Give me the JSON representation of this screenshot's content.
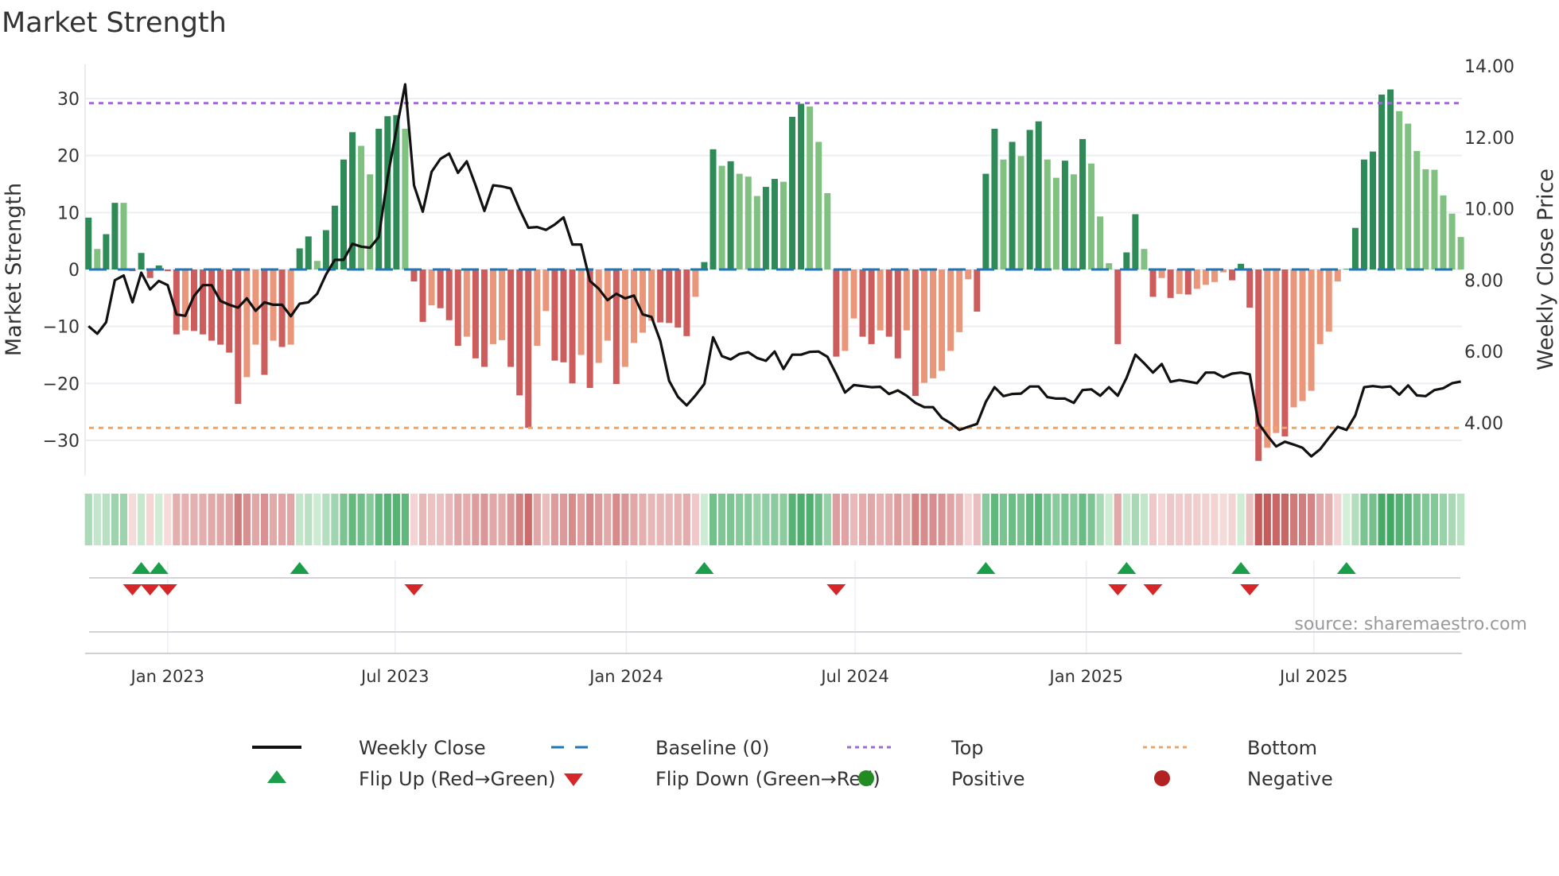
{
  "title": "Market Strength",
  "source": "source: sharemaestro.com",
  "chart_data": {
    "type": "bar",
    "title": "Market Strength",
    "ylabel": "Market Strength",
    "y2label": "Weekly Close Price",
    "ylim": [
      -36,
      36
    ],
    "y2lim": [
      2.55,
      14.05
    ],
    "yticks": [
      "30",
      "20",
      "10",
      "0",
      "−10",
      "−20",
      "−30"
    ],
    "ytick_values": [
      30,
      20,
      10,
      0,
      -10,
      -20,
      -30
    ],
    "y2ticks": [
      "14.00",
      "12.00",
      "10.00",
      "8.00",
      "6.00",
      "4.00"
    ],
    "y2tick_values": [
      14,
      12,
      10,
      8,
      6,
      4
    ],
    "xticks": [
      {
        "label": "Jan 2023",
        "date": "2023-01-01"
      },
      {
        "label": "Jul 2023",
        "date": "2023-07-01"
      },
      {
        "label": "Jan 2024",
        "date": "2024-01-01"
      },
      {
        "label": "Jul 2024",
        "date": "2024-07-01"
      },
      {
        "label": "Jan 2025",
        "date": "2025-01-01"
      },
      {
        "label": "Jul 2025",
        "date": "2025-07-01"
      }
    ],
    "x_start": "2022-10-30",
    "x_step_days": 7,
    "grid": true,
    "top_level": 29.2,
    "bottom_level": -27.8,
    "baseline": 0,
    "strength_values": [
      9.1,
      3.6,
      6.2,
      11.7,
      11.7,
      -0.3,
      2.9,
      -1.5,
      0.7,
      -0.3,
      -11.4,
      -10.7,
      -10.8,
      -11.4,
      -12.5,
      -13.2,
      -14.6,
      -23.6,
      -18.9,
      -13.2,
      -18.5,
      -12.5,
      -13.6,
      -13.2,
      3.7,
      5.8,
      1.5,
      6.9,
      11.2,
      19.3,
      24.1,
      21.7,
      16.7,
      24.7,
      26.9,
      27.1,
      24.7,
      -2.1,
      -9.2,
      -6.3,
      -6.8,
      -8.9,
      -13.4,
      -11.8,
      -15.6,
      -17.1,
      -13.1,
      -12.4,
      -17.1,
      -22.1,
      -27.8,
      -13.4,
      -7.3,
      -16.0,
      -16.3,
      -20.0,
      -15.0,
      -20.8,
      -16.4,
      -12.5,
      -20.1,
      -17.1,
      -12.9,
      -11.1,
      -9.0,
      -9.3,
      -9.4,
      -10.2,
      -11.7,
      -4.8,
      1.3,
      21.1,
      18.2,
      19.0,
      16.8,
      16.3,
      12.9,
      14.5,
      15.9,
      15.4,
      26.8,
      29.1,
      28.6,
      22.4,
      13.4,
      -15.3,
      -14.3,
      -8.6,
      -11.8,
      -13.1,
      -10.7,
      -11.8,
      -15.6,
      -10.7,
      -22.2,
      -19.9,
      -19.1,
      -17.8,
      -14.3,
      -11.0,
      -1.7,
      -7.4,
      16.8,
      24.7,
      19.3,
      22.4,
      19.9,
      24.5,
      26.0,
      19.3,
      16.1,
      19.1,
      16.7,
      22.9,
      18.6,
      9.3,
      1.1,
      -13.1,
      3.0,
      9.7,
      3.6,
      -4.8,
      -1.5,
      -5.0,
      -4.3,
      -4.4,
      -3.4,
      -2.7,
      -2.2,
      -0.5,
      -1.9,
      1.0,
      -6.7,
      -33.6,
      -31.3,
      -28.7,
      -29.3,
      -24.2,
      -23.1,
      -21.3,
      -13.1,
      -10.9,
      -2.1,
      0.1,
      7.3,
      19.3,
      20.7,
      30.7,
      31.6,
      27.8,
      25.6,
      20.8,
      17.6,
      17.5,
      13.0,
      9.8,
      5.7
    ],
    "weekly_close": [
      6.71,
      6.5,
      6.82,
      8.0,
      8.13,
      7.38,
      8.21,
      7.74,
      7.98,
      7.86,
      7.04,
      7.0,
      7.56,
      7.86,
      7.86,
      7.42,
      7.31,
      7.23,
      7.49,
      7.14,
      7.38,
      7.31,
      7.31,
      6.99,
      7.34,
      7.38,
      7.62,
      8.16,
      8.57,
      8.57,
      9.02,
      8.94,
      8.91,
      9.21,
      10.89,
      12.22,
      13.49,
      10.66,
      9.92,
      11.04,
      11.4,
      11.55,
      11.01,
      11.33,
      10.66,
      9.94,
      10.66,
      10.63,
      10.57,
      9.99,
      9.47,
      9.49,
      9.41,
      9.56,
      9.76,
      9.0,
      9.0,
      7.98,
      7.76,
      7.44,
      7.62,
      7.49,
      7.57,
      7.04,
      6.97,
      6.3,
      5.18,
      4.73,
      4.49,
      4.77,
      5.09,
      6.4,
      5.87,
      5.78,
      5.93,
      5.98,
      5.82,
      5.74,
      6.0,
      5.51,
      5.91,
      5.91,
      5.99,
      6.0,
      5.85,
      5.37,
      4.85,
      5.06,
      5.03,
      5.0,
      5.01,
      4.81,
      4.91,
      4.76,
      4.56,
      4.44,
      4.44,
      4.14,
      3.99,
      3.8,
      3.89,
      3.97,
      4.59,
      5.0,
      4.75,
      4.81,
      4.82,
      5.02,
      5.02,
      4.72,
      4.68,
      4.68,
      4.56,
      4.92,
      4.94,
      4.76,
      5.0,
      4.76,
      5.26,
      5.91,
      5.67,
      5.41,
      5.65,
      5.15,
      5.2,
      5.16,
      5.11,
      5.41,
      5.41,
      5.28,
      5.38,
      5.41,
      5.36,
      3.99,
      3.64,
      3.34,
      3.47,
      3.39,
      3.3,
      3.06,
      3.26,
      3.58,
      3.89,
      3.8,
      4.21,
      5.0,
      5.03,
      5.0,
      5.02,
      4.79,
      5.05,
      4.77,
      4.75,
      4.92,
      4.97,
      5.11,
      5.16
    ],
    "legend": {
      "placement": "bottom",
      "items": [
        {
          "label": "Weekly Close",
          "symbol": "line"
        },
        {
          "label": "Baseline (0)",
          "symbol": "dash"
        },
        {
          "label": "Top",
          "symbol": "dot"
        },
        {
          "label": "Bottom",
          "symbol": "dot"
        },
        {
          "label": "Flip Up (Red→Green)",
          "symbol": "triangle-up"
        },
        {
          "label": "Flip Down (Green→Red)",
          "symbol": "triangle-down"
        },
        {
          "label": "Positive",
          "symbol": "circle"
        },
        {
          "label": "Negative",
          "symbol": "circle"
        }
      ]
    }
  },
  "colors": {
    "pos_strong": "#2e8b57",
    "pos_weak": "#80c080",
    "neg_strong": "#cd5c5c",
    "neg_weak": "#e9967a",
    "close": "#111111",
    "baseline": "#1f77b4",
    "top": "#a066dd",
    "bottom": "#f4a460",
    "flip_up": "#1a9e4a",
    "flip_down": "#d62728",
    "positive": "#228b22",
    "negative": "#b22222",
    "grid": "#eceef4"
  }
}
